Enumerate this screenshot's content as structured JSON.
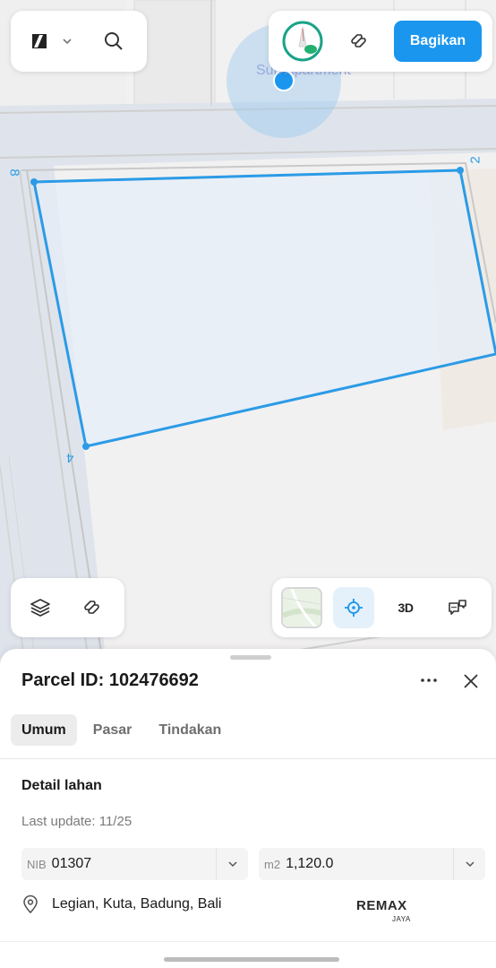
{
  "map": {
    "poi_label": "Sun Apartment",
    "vertex_labels": [
      "8",
      "2",
      "4"
    ]
  },
  "toolbar": {
    "logo_icon": "app-logo-icon",
    "share_label": "Bagikan"
  },
  "map_controls": {
    "three_d_label": "3D"
  },
  "sheet": {
    "title": "Parcel ID: 102476692",
    "tabs": [
      {
        "label": "Umum",
        "active": true
      },
      {
        "label": "Pasar",
        "active": false
      },
      {
        "label": "Tindakan",
        "active": false
      }
    ],
    "section_title": "Detail lahan",
    "last_update": "Last update: 11/25",
    "fields": {
      "nib_label": "NIB",
      "nib_value": "01307",
      "area_label": "m2",
      "area_value": "1,120.0"
    },
    "address": "Legian, Kuta, Badung, Bali",
    "logo": {
      "brand": "REMAX",
      "sub": "JAYA"
    }
  },
  "colors": {
    "accent": "#1a96ee",
    "parcel_outline": "#2b9be6"
  }
}
